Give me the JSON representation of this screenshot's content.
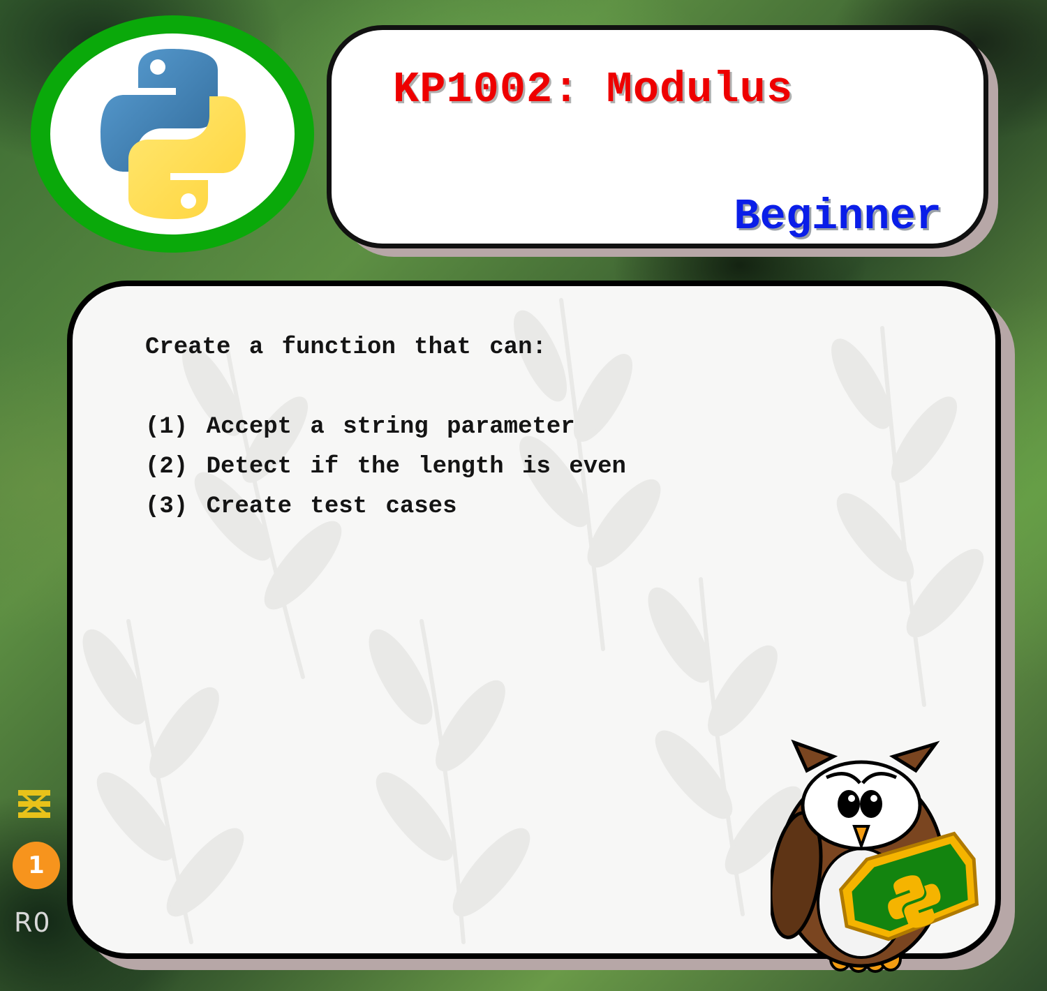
{
  "header": {
    "title": "KP1002: Modulus",
    "level": "Beginner"
  },
  "task": {
    "intro": "Create a function that can:",
    "items": [
      "(1) Accept a string parameter",
      "(2) Detect if the length is even",
      "(3) Create test cases"
    ]
  },
  "sidebar": {
    "badge_count": "1",
    "round_label": "R0"
  },
  "icons": {
    "logo": "python-logo-icon",
    "stack": "stack-icon",
    "mascot": "owl-mascot-icon",
    "shield": "python-shield-icon"
  },
  "colors": {
    "title": "#ee0000",
    "level": "#0a1ee8",
    "logo_ring": "#0aa90a",
    "badge": "#f7941d",
    "python_blue": "#3a72a8",
    "python_yellow": "#f9d648"
  }
}
